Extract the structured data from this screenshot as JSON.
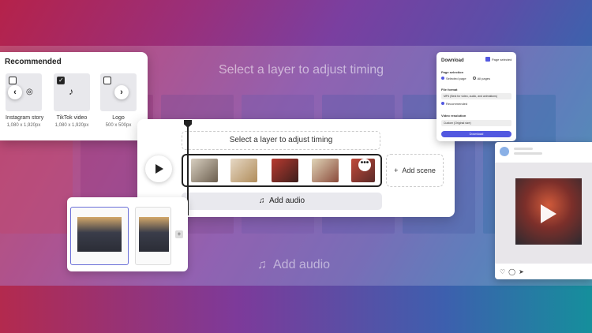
{
  "background": {
    "title": "Select a layer to adjust timing",
    "audio_label": "Add audio"
  },
  "recommended": {
    "title": "Recommended",
    "items": [
      {
        "name": "Instagram story",
        "size": "1,080 x 1,920px",
        "checked": false
      },
      {
        "name": "TikTok video",
        "size": "1,080 x 1,920px",
        "checked": true
      },
      {
        "name": "Logo",
        "size": "500 x 500px",
        "checked": false
      }
    ]
  },
  "timing": {
    "hint": "Select a layer to adjust timing",
    "add_scene": "Add scene",
    "add_audio": "Add audio",
    "more": "•••"
  },
  "download": {
    "title": "Download",
    "badge": "Page selected",
    "page_selection_label": "Page selection",
    "opt_selected": "Selected page",
    "opt_all": "All pages",
    "file_format_label": "File format",
    "file_format_value": "MP4 (Best for video, audio, and animations)",
    "recommended": "Recommended",
    "resolution_label": "Video resolution",
    "resolution_value": "Custom (Original size)",
    "button": "Download"
  },
  "colors": {
    "accent": "#5258e0"
  }
}
